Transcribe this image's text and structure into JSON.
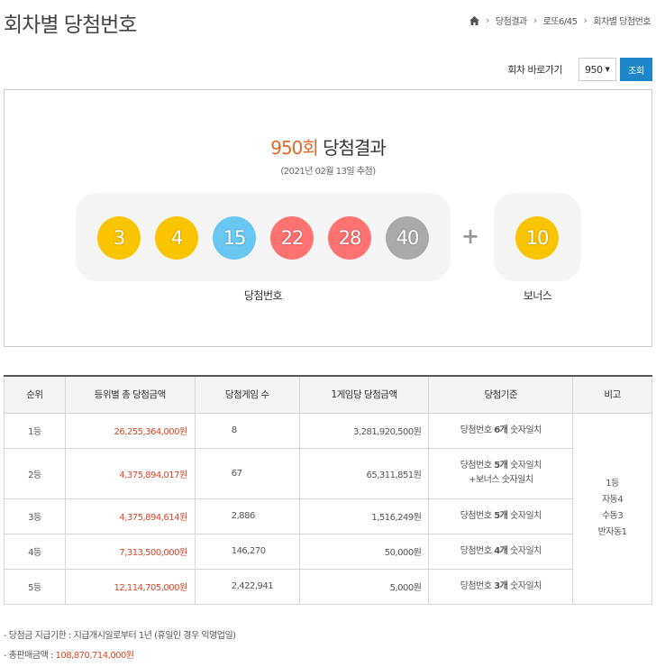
{
  "page_title": "회차별 당첨번호",
  "breadcrumb": {
    "items": [
      "당첨결과",
      "로또6/45",
      "회차별 당첨번호"
    ]
  },
  "goto": {
    "label": "회차 바로가기",
    "selected_round": "950",
    "button_label": "조회"
  },
  "result": {
    "round": "950회",
    "title_suffix": "당첨결과",
    "date": "(2021년 02월 13일 추첨)",
    "numbers": [
      {
        "value": "3",
        "color": "#fbc400"
      },
      {
        "value": "4",
        "color": "#fbc400"
      },
      {
        "value": "15",
        "color": "#69c8f2"
      },
      {
        "value": "22",
        "color": "#ff7272"
      },
      {
        "value": "28",
        "color": "#ff7272"
      },
      {
        "value": "40",
        "color": "#aaaaaa"
      }
    ],
    "bonus": {
      "value": "10",
      "color": "#fbc400"
    },
    "main_label": "당첨번호",
    "bonus_label": "보너스"
  },
  "table": {
    "headers": [
      "순위",
      "등위별 총 당첨금액",
      "당첨게임 수",
      "1게임당 당첨금액",
      "당첨기준",
      "비고"
    ],
    "rows": [
      {
        "rank": "1등",
        "total": "26,255,364,000원",
        "count": "8",
        "per_game": "3,281,920,500원",
        "crit_pre": "당첨번호 ",
        "crit_bold": "6개",
        "crit_post": " 숫자일치",
        "crit_line2": ""
      },
      {
        "rank": "2등",
        "total": "4,375,894,017원",
        "count": "67",
        "per_game": "65,311,851원",
        "crit_pre": "당첨번호 ",
        "crit_bold": "5개",
        "crit_post": " 숫자일치",
        "crit_line2": "+보너스 숫자일치"
      },
      {
        "rank": "3등",
        "total": "4,375,894,614원",
        "count": "2,886",
        "per_game": "1,516,249원",
        "crit_pre": "당첨번호 ",
        "crit_bold": "5개",
        "crit_post": " 숫자일치",
        "crit_line2": ""
      },
      {
        "rank": "4등",
        "total": "7,313,500,000원",
        "count": "146,270",
        "per_game": "50,000원",
        "crit_pre": "당첨번호 ",
        "crit_bold": "4개",
        "crit_post": " 숫자일치",
        "crit_line2": ""
      },
      {
        "rank": "5등",
        "total": "12,114,705,000원",
        "count": "2,422,941",
        "per_game": "5,000원",
        "crit_pre": "당첨번호 ",
        "crit_bold": "3개",
        "crit_post": " 숫자일치",
        "crit_line2": ""
      }
    ],
    "note": [
      "1등",
      "자동4",
      "수동3",
      "반자동1"
    ]
  },
  "notes": {
    "line1": "-  당첨금 지급기한 : 지급개시일로부터 1년 (휴일인 경우 익영업일)",
    "line2_label": "-  총판매금액 : ",
    "line2_amount": "108,870,714,000원"
  }
}
